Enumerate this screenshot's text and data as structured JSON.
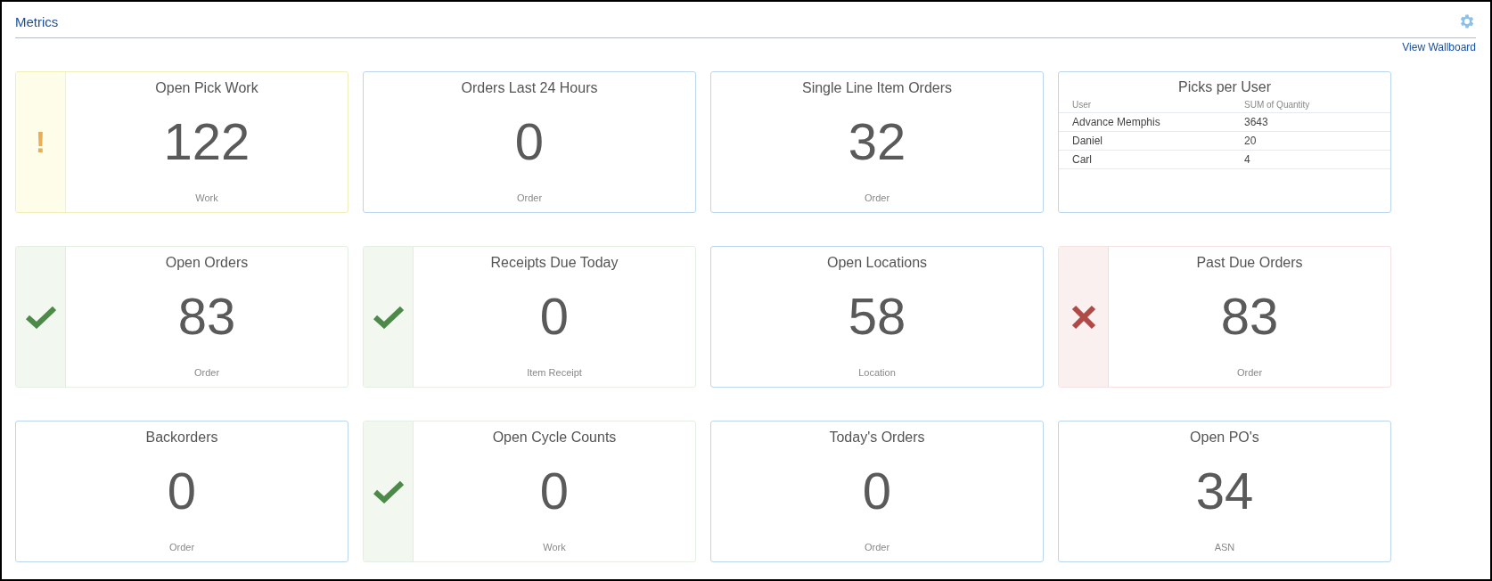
{
  "header": {
    "title": "Metrics",
    "link": "View Wallboard"
  },
  "cards": [
    {
      "kind": "warning",
      "icon": "!",
      "title": "Open Pick Work",
      "value": "122",
      "unit": "Work"
    },
    {
      "kind": "plain",
      "title": "Orders Last 24 Hours",
      "value": "0",
      "unit": "Order"
    },
    {
      "kind": "plain",
      "title": "Single Line Item Orders",
      "value": "32",
      "unit": "Order"
    },
    {
      "kind": "table",
      "title": "Picks per User",
      "columns": [
        "User",
        "SUM of Quantity"
      ],
      "rows": [
        [
          "Advance Memphis",
          "3643"
        ],
        [
          "Daniel",
          "20"
        ],
        [
          "Carl",
          "4"
        ]
      ]
    },
    {
      "kind": "ok",
      "title": "Open Orders",
      "value": "83",
      "unit": "Order"
    },
    {
      "kind": "ok",
      "title": "Receipts Due Today",
      "value": "0",
      "unit": "Item Receipt"
    },
    {
      "kind": "plain",
      "title": "Open Locations",
      "value": "58",
      "unit": "Location"
    },
    {
      "kind": "error",
      "title": "Past Due Orders",
      "value": "83",
      "unit": "Order"
    },
    {
      "kind": "plain",
      "title": "Backorders",
      "value": "0",
      "unit": "Order"
    },
    {
      "kind": "ok",
      "title": "Open Cycle Counts",
      "value": "0",
      "unit": "Work"
    },
    {
      "kind": "plain",
      "title": "Today's Orders",
      "value": "0",
      "unit": "Order"
    },
    {
      "kind": "plain",
      "title": "Open PO's",
      "value": "34",
      "unit": "ASN"
    }
  ]
}
